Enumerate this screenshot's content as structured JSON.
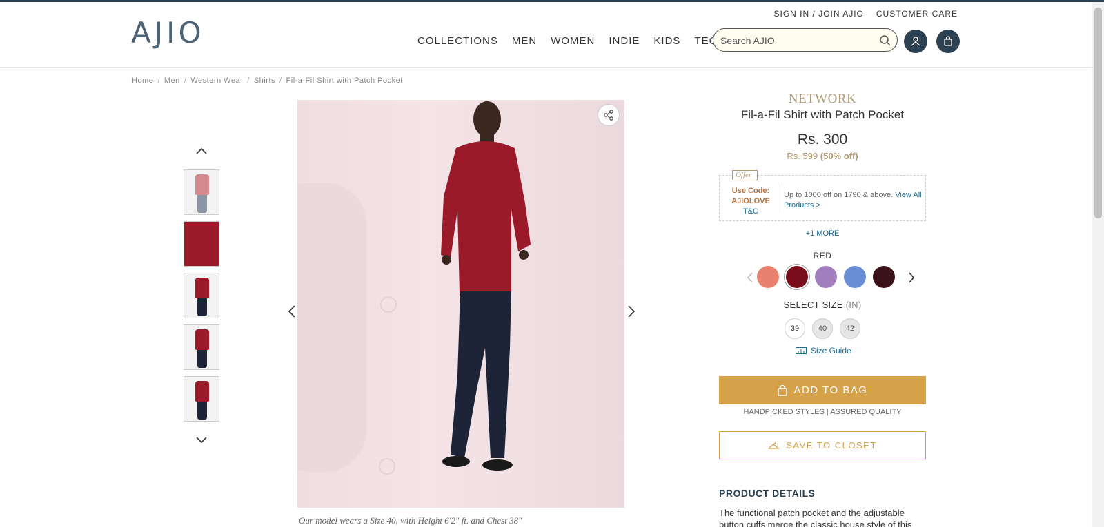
{
  "header": {
    "logo": "AJIO",
    "top_links": [
      "SIGN IN",
      "/",
      "JOIN AJIO",
      "CUSTOMER CARE"
    ],
    "nav": [
      "COLLECTIONS",
      "MEN",
      "WOMEN",
      "INDIE",
      "KIDS",
      "TECH"
    ],
    "search_placeholder": "Search AJIO",
    "icons": [
      "search-icon",
      "user-icon",
      "bag-icon"
    ],
    "accent_color": "#2c4152"
  },
  "breadcrumb": [
    "Home",
    "Men",
    "Western Wear",
    "Shirts",
    "Fil-a-Fil Shirt with Patch Pocket"
  ],
  "gallery": {
    "thumbnail_count": 5,
    "model_note": "Our model wears a Size 40, with Height 6'2\" ft. and Chest 38\""
  },
  "product": {
    "brand": "NETWORK",
    "name": "Fil-a-Fil Shirt with Patch Pocket",
    "price": "Rs. 300",
    "mrp": "Rs. 599",
    "discount": "(50% off)",
    "offer": {
      "tag": "Offer",
      "code_label": "Use Code:",
      "code": "AJIOLOVE",
      "tc": "T&C",
      "text": "Up to 1000 off on 1790 & above.",
      "link": "View All Products >"
    },
    "more_offers": "+1 MORE",
    "selected_color": "RED",
    "colors": [
      "#e8826f",
      "#7a0d1c",
      "#a17fbf",
      "#6a8ed6",
      "#3b121a"
    ],
    "size_label": "SELECT SIZE",
    "size_unit": "(IN)",
    "sizes": [
      "39",
      "40",
      "42"
    ],
    "size_guide": "Size Guide",
    "add_to_bag": "ADD TO BAG",
    "assured": "HANDPICKED STYLES | ASSURED QUALITY",
    "save_to_closet": "SAVE TO CLOSET",
    "details_title": "PRODUCT DETAILS",
    "details_text": "The functional patch pocket and the adjustable button cuffs merge the classic house style of this"
  }
}
